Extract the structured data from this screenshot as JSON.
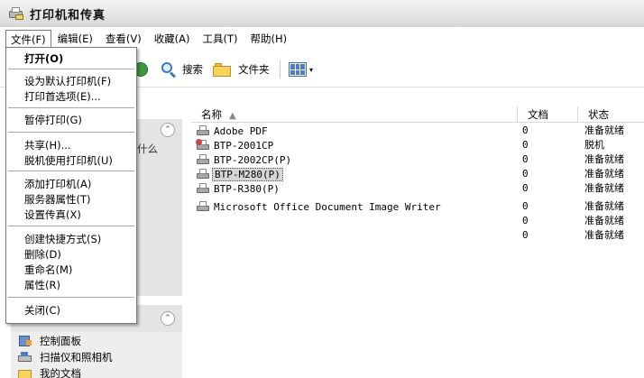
{
  "window": {
    "title": "打印机和传真"
  },
  "menubar": {
    "items": [
      "文件(F)",
      "编辑(E)",
      "查看(V)",
      "收藏(A)",
      "工具(T)",
      "帮助(H)"
    ]
  },
  "toolbar": {
    "search_label": "搜索",
    "folders_label": "文件夹"
  },
  "file_menu": {
    "open": "打开(O)",
    "set_default": "设为默认打印机(F)",
    "preferences": "打印首选项(E)...",
    "pause": "暂停打印(G)",
    "share": "共享(H)...",
    "offline": "脱机使用打印机(U)",
    "add_printer": "添加打印机(A)",
    "server_props": "服务器属性(T)",
    "fax_setup": "设置传真(X)",
    "create_shortcut": "创建快捷方式(S)",
    "delete": "删除(D)",
    "rename": "重命名(M)",
    "properties": "属性(R)",
    "close": "关闭(C)"
  },
  "sidebar": {
    "partial_text": "什么",
    "other_places": [
      "控制面板",
      "扫描仪和照相机",
      "我的文档"
    ]
  },
  "list": {
    "columns": {
      "name": "名称",
      "documents": "文档",
      "status": "状态"
    },
    "rows": [
      {
        "name": "Adobe PDF",
        "documents": "0",
        "status": "准备就绪"
      },
      {
        "name": "BTP-2001CP",
        "documents": "0",
        "status": "脱机"
      },
      {
        "name": "BTP-2002CP(P)",
        "documents": "0",
        "status": "准备就绪"
      },
      {
        "name": "BTP-M280(P)",
        "documents": "0",
        "status": "准备就绪"
      },
      {
        "name": "BTP-R380(P)",
        "documents": "0",
        "status": "准备就绪"
      },
      {
        "name": "Microsoft Office Document Image Writer",
        "documents": "0",
        "status": "准备就绪"
      },
      {
        "name": "",
        "documents": "0",
        "status": "准备就绪"
      },
      {
        "name": "",
        "documents": "0",
        "status": "准备就绪"
      }
    ]
  }
}
